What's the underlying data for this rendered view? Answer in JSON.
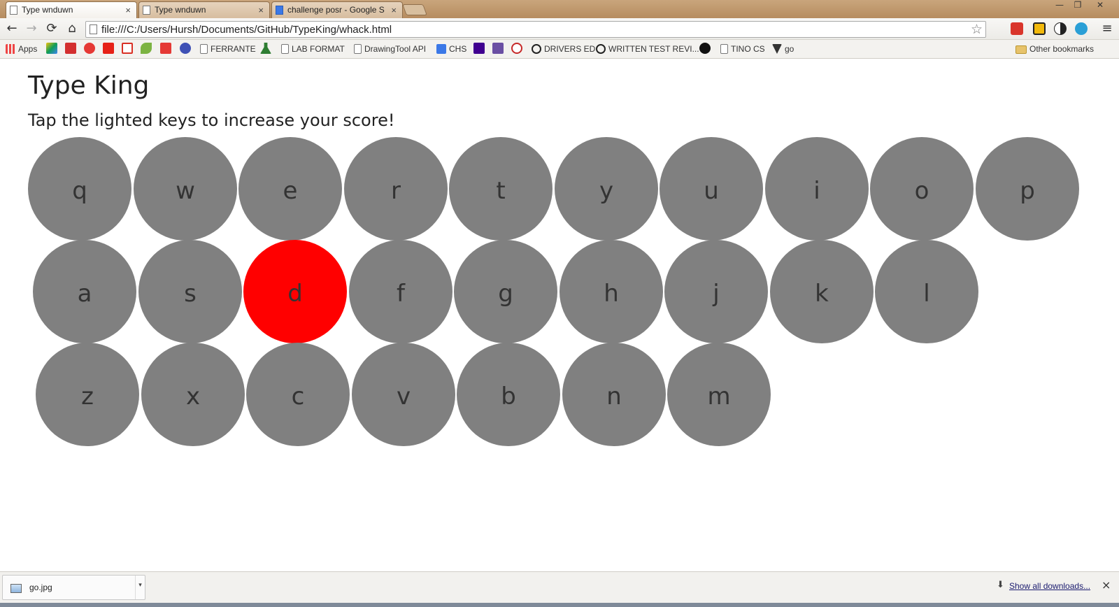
{
  "browser": {
    "tabs": [
      {
        "title": "Type wnduwn",
        "active": true
      },
      {
        "title": "Type wnduwn",
        "active": false
      },
      {
        "title": "challenge posr - Google S",
        "active": false
      }
    ],
    "close_glyph": "×",
    "address": "file:///C:/Users/Hursh/Documents/GitHub/TypeKing/whack.html",
    "nav": {
      "back": "←",
      "forward": "→",
      "reload": "⟳",
      "home": "⌂"
    },
    "star": "☆",
    "menu": "≡",
    "window_controls": {
      "minimize": "—",
      "restore": "❐",
      "close": "✕"
    }
  },
  "bookmarks": {
    "apps": "Apps",
    "items": [
      "FERRANTE",
      "LAB FORMAT",
      "DrawingTool API",
      "CHS",
      "DRIVERS ED",
      "WRITTEN TEST REVI...",
      "TINO CS",
      "go"
    ],
    "other": "Other bookmarks"
  },
  "page": {
    "title": "Type King",
    "instructions": "Tap the lighted keys to increase your score!",
    "rows": [
      [
        "q",
        "w",
        "e",
        "r",
        "t",
        "y",
        "u",
        "i",
        "o",
        "p"
      ],
      [
        "a",
        "s",
        "d",
        "f",
        "g",
        "h",
        "j",
        "k",
        "l"
      ],
      [
        "z",
        "x",
        "c",
        "v",
        "b",
        "n",
        "m"
      ]
    ],
    "lit_key": "d",
    "colors": {
      "key": "#808080",
      "lit": "#ff0000",
      "text": "#333333"
    }
  },
  "downloads": {
    "file": "go.jpg",
    "show_all": "Show all downloads...",
    "close": "×"
  }
}
